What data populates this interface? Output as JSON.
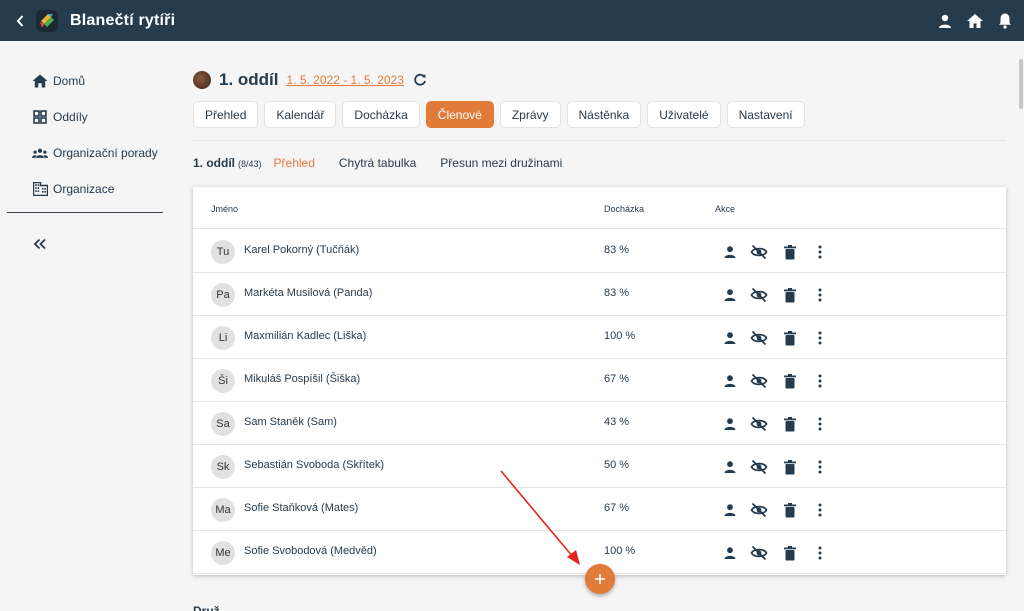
{
  "app": {
    "title": "Blanečtí rytíři"
  },
  "colors": {
    "topbar": "#253b4e",
    "accent": "#e07b3a",
    "annotation_arrow": "#e8231f"
  },
  "topbar_icons": [
    "person-icon",
    "home-icon",
    "bell-icon"
  ],
  "sidebar": {
    "items": [
      {
        "label": "Domů",
        "icon": "home-icon"
      },
      {
        "label": "Oddíly",
        "icon": "grid-icon"
      },
      {
        "label": "Organizační porady",
        "icon": "groups-icon"
      },
      {
        "label": "Organizace",
        "icon": "building-icon"
      }
    ]
  },
  "header": {
    "title": "1. oddíl",
    "date_range": "1. 5. 2022 - 1. 5. 2023"
  },
  "tabs": [
    {
      "label": "Přehled",
      "active": false
    },
    {
      "label": "Kalendář",
      "active": false
    },
    {
      "label": "Docházka",
      "active": false
    },
    {
      "label": "Členové",
      "active": true
    },
    {
      "label": "Zprávy",
      "active": false
    },
    {
      "label": "Nástěnka",
      "active": false
    },
    {
      "label": "Uživatelé",
      "active": false
    },
    {
      "label": "Nastavení",
      "active": false
    }
  ],
  "subnav": {
    "unit": "1. oddíl",
    "count": "(8/43)",
    "links": [
      {
        "label": "Přehled",
        "active": true
      },
      {
        "label": "Chytrá tabulka",
        "active": false
      },
      {
        "label": "Přesun mezi družinami",
        "active": false
      }
    ]
  },
  "table": {
    "headers": {
      "name": "Jméno",
      "attendance": "Docházka",
      "actions": "Akce"
    },
    "rows": [
      {
        "initials": "Tu",
        "name": "Karel Pokorný (Tučňák)",
        "attendance": "83 %"
      },
      {
        "initials": "Pa",
        "name": "Markéta Musilová (Panda)",
        "attendance": "83 %"
      },
      {
        "initials": "Li",
        "name": "Maxmilián Kadlec (Liška)",
        "attendance": "100 %"
      },
      {
        "initials": "Ši",
        "name": "Mikuláš Pospíšil (Šiška)",
        "attendance": "67 %"
      },
      {
        "initials": "Sa",
        "name": "Sam Staněk (Sam)",
        "attendance": "43 %"
      },
      {
        "initials": "Sk",
        "name": "Sebastián Svoboda (Skřítek)",
        "attendance": "50 %"
      },
      {
        "initials": "Ma",
        "name": "Sofie Staňková (Mates)",
        "attendance": "67 %"
      },
      {
        "initials": "Me",
        "name": "Sofie Svobodová (Medvěd)",
        "attendance": "100 %"
      }
    ],
    "row_actions": [
      "person-icon",
      "visibility-off-icon",
      "trash-icon",
      "more-vert-icon"
    ]
  },
  "fab": {
    "icon": "plus-icon"
  }
}
